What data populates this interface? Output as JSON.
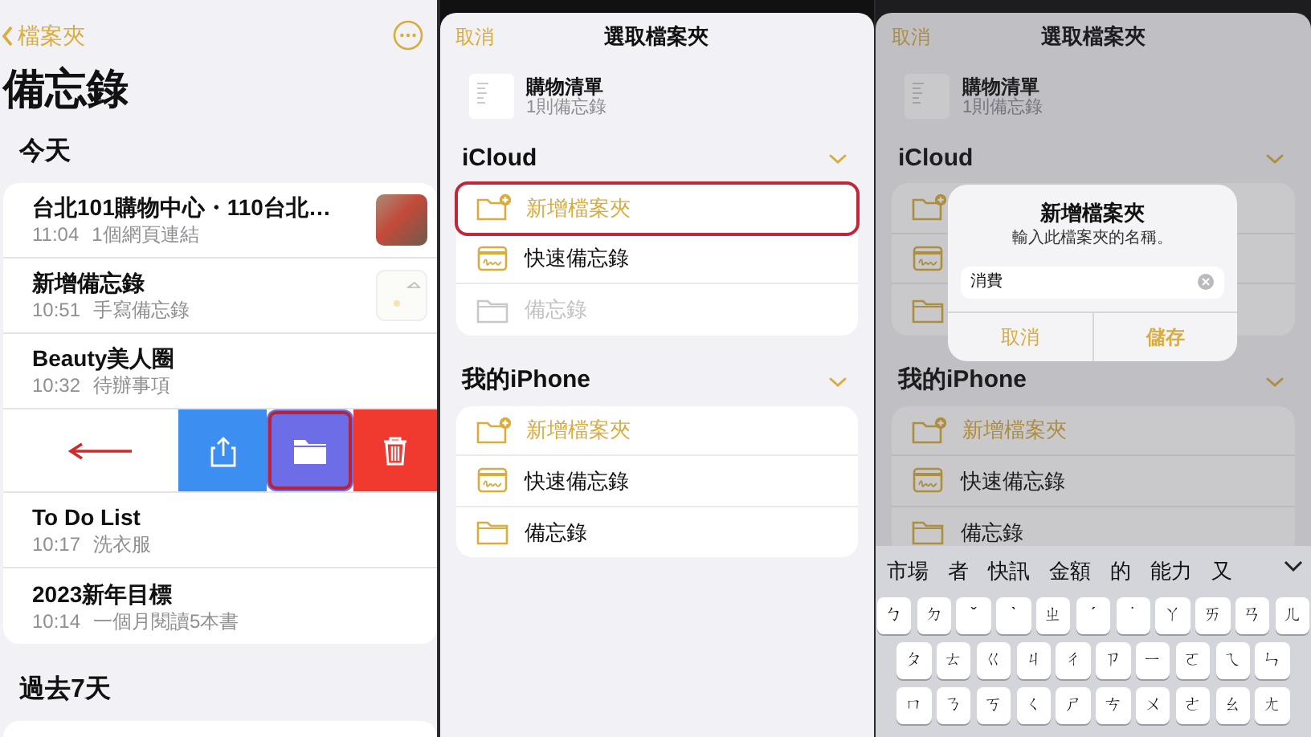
{
  "notes_screen": {
    "back_label": "檔案夾",
    "title": "備忘錄",
    "today_heading": "今天",
    "rows": [
      {
        "kind": "note",
        "title": "台北101購物中心・110台北…",
        "time": "11:04",
        "preview": "1個網頁連結",
        "thumbnail": {
          "kind": "photo"
        }
      },
      {
        "kind": "note",
        "title": "新增備忘錄",
        "time": "10:51",
        "preview": "手寫備忘錄",
        "thumbnail": {
          "kind": "sketch"
        }
      },
      {
        "kind": "note",
        "title": "Beauty美人圈",
        "time": "10:32",
        "preview": "待辦事項"
      },
      {
        "kind": "swipe",
        "actions": [
          {
            "kind": "share",
            "highlighted": false
          },
          {
            "kind": "move",
            "highlighted": true
          },
          {
            "kind": "delete",
            "highlighted": false
          }
        ]
      },
      {
        "kind": "note",
        "title": "To Do List",
        "time": "10:17",
        "preview": "洗衣服"
      },
      {
        "kind": "note",
        "title": "2023新年目標",
        "time": "10:14",
        "preview": "一個月閱讀5本書"
      }
    ],
    "past_heading": "過去7天"
  },
  "folder_picker": {
    "cancel": "取消",
    "title": "選取檔案夾",
    "note": {
      "title": "購物清單",
      "subtitle": "1則備忘錄"
    },
    "groups": [
      {
        "name": "iCloud",
        "expanded": true,
        "folders": [
          {
            "kind": "new-folder",
            "label": "新增檔案夾",
            "highlighted": true,
            "disabled": false
          },
          {
            "kind": "quick-note",
            "label": "快速備忘錄",
            "highlighted": false,
            "disabled": false
          },
          {
            "kind": "folder",
            "label": "備忘錄",
            "highlighted": false,
            "disabled": true
          }
        ]
      },
      {
        "name": "我的iPhone",
        "expanded": true,
        "folders": [
          {
            "kind": "new-folder",
            "label": "新增檔案夾",
            "highlighted": false,
            "disabled": false
          },
          {
            "kind": "quick-note",
            "label": "快速備忘錄",
            "highlighted": false,
            "disabled": false
          },
          {
            "kind": "folder",
            "label": "備忘錄",
            "highlighted": false,
            "disabled": false
          }
        ]
      }
    ]
  },
  "new_folder_screen": {
    "picker": {
      "cancel": "取消",
      "title": "選取檔案夾",
      "note": {
        "title": "購物清單",
        "subtitle": "1則備忘錄"
      },
      "groups": [
        {
          "name": "iCloud",
          "expanded": true,
          "folders": [
            {
              "kind": "new-folder",
              "highlighted": false,
              "disabled": false
            },
            {
              "kind": "quick-note",
              "highlighted": false,
              "disabled": false
            },
            {
              "kind": "folder",
              "highlighted": false,
              "disabled": false
            }
          ]
        },
        {
          "name": "我的iPhone",
          "expanded": true,
          "folders": [
            {
              "kind": "new-folder",
              "label": "新增檔案夾",
              "highlighted": false,
              "disabled": false
            },
            {
              "kind": "quick-note",
              "label": "快速備忘錄",
              "highlighted": false,
              "disabled": false
            },
            {
              "kind": "folder",
              "label": "備忘錄",
              "highlighted": false,
              "disabled": false
            }
          ]
        }
      ]
    },
    "dialog": {
      "title": "新增檔案夾",
      "message": "輸入此檔案夾的名稱。",
      "value": "消費",
      "buttons": [
        "取消",
        "儲存"
      ]
    },
    "keyboard": {
      "candidates": [
        "市場",
        "者",
        "快訊",
        "金額",
        "的",
        "能力",
        "又"
      ],
      "rows": [
        [
          "ㄅ",
          "ㄉ",
          "ˇ",
          "ˋ",
          "ㄓ",
          "ˊ",
          "˙",
          "ㄚ",
          "ㄞ",
          "ㄢ",
          "ㄦ"
        ],
        [
          "ㄆ",
          "ㄊ",
          "ㄍ",
          "ㄐ",
          "ㄔ",
          "ㄗ",
          "ㄧ",
          "ㄛ",
          "ㄟ",
          "ㄣ"
        ],
        [
          "ㄇ",
          "ㄋ",
          "ㄎ",
          "ㄑ",
          "ㄕ",
          "ㄘ",
          "ㄨ",
          "ㄜ",
          "ㄠ",
          "ㄤ"
        ]
      ]
    }
  }
}
